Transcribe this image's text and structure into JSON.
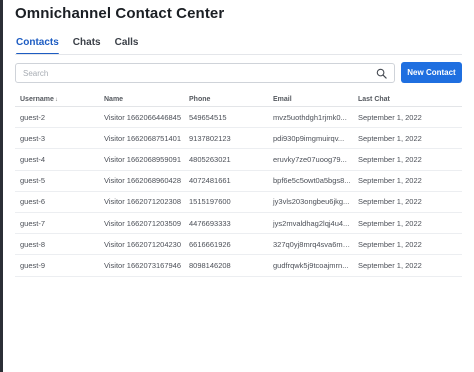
{
  "header": {
    "title": "Omnichannel Contact Center"
  },
  "tabs": [
    {
      "label": "Contacts",
      "active": true
    },
    {
      "label": "Chats",
      "active": false
    },
    {
      "label": "Calls",
      "active": false
    }
  ],
  "search": {
    "placeholder": "Search",
    "value": "",
    "icon": "search-icon"
  },
  "toolbar": {
    "new_contact_label": "New Contact"
  },
  "colors": {
    "accent": "#1f6fe0",
    "active_tab": "#1d5cc2"
  },
  "table": {
    "columns": [
      "Username",
      "Name",
      "Phone",
      "Email",
      "Last Chat"
    ],
    "sort_indicator": "↓",
    "rows": [
      {
        "username": "guest-2",
        "name": "Visitor 1662066446845",
        "phone": "549654515",
        "email": "mvz5uothdgh1rjmk0...",
        "last_chat": "September 1, 2022"
      },
      {
        "username": "guest-3",
        "name": "Visitor 1662068751401",
        "phone": "9137802123",
        "email": "pdi930p9imgmuirqv...",
        "last_chat": "September 1, 2022"
      },
      {
        "username": "guest-4",
        "name": "Visitor 1662068959091",
        "phone": "4805263021",
        "email": "eruvky7ze07uoog79...",
        "last_chat": "September 1, 2022"
      },
      {
        "username": "guest-5",
        "name": "Visitor 1662068960428",
        "phone": "4072481661",
        "email": "bpf6e5c5owt0a5bgs8...",
        "last_chat": "September 1, 2022"
      },
      {
        "username": "guest-6",
        "name": "Visitor 1662071202308",
        "phone": "1515197600",
        "email": "jy3vls203ongbeu6jkg...",
        "last_chat": "September 1, 2022"
      },
      {
        "username": "guest-7",
        "name": "Visitor 1662071203509",
        "phone": "4476693333",
        "email": "jys2mvaldhag2lqj4u4...",
        "last_chat": "September 1, 2022"
      },
      {
        "username": "guest-8",
        "name": "Visitor 1662071204230",
        "phone": "6616661926",
        "email": "327q0yj8mrq4sva6mh...",
        "last_chat": "September 1, 2022"
      },
      {
        "username": "guest-9",
        "name": "Visitor 1662073167946",
        "phone": "8098146208",
        "email": "gudfrqwk5j9tcoajmrn...",
        "last_chat": "September 1, 2022"
      }
    ]
  }
}
